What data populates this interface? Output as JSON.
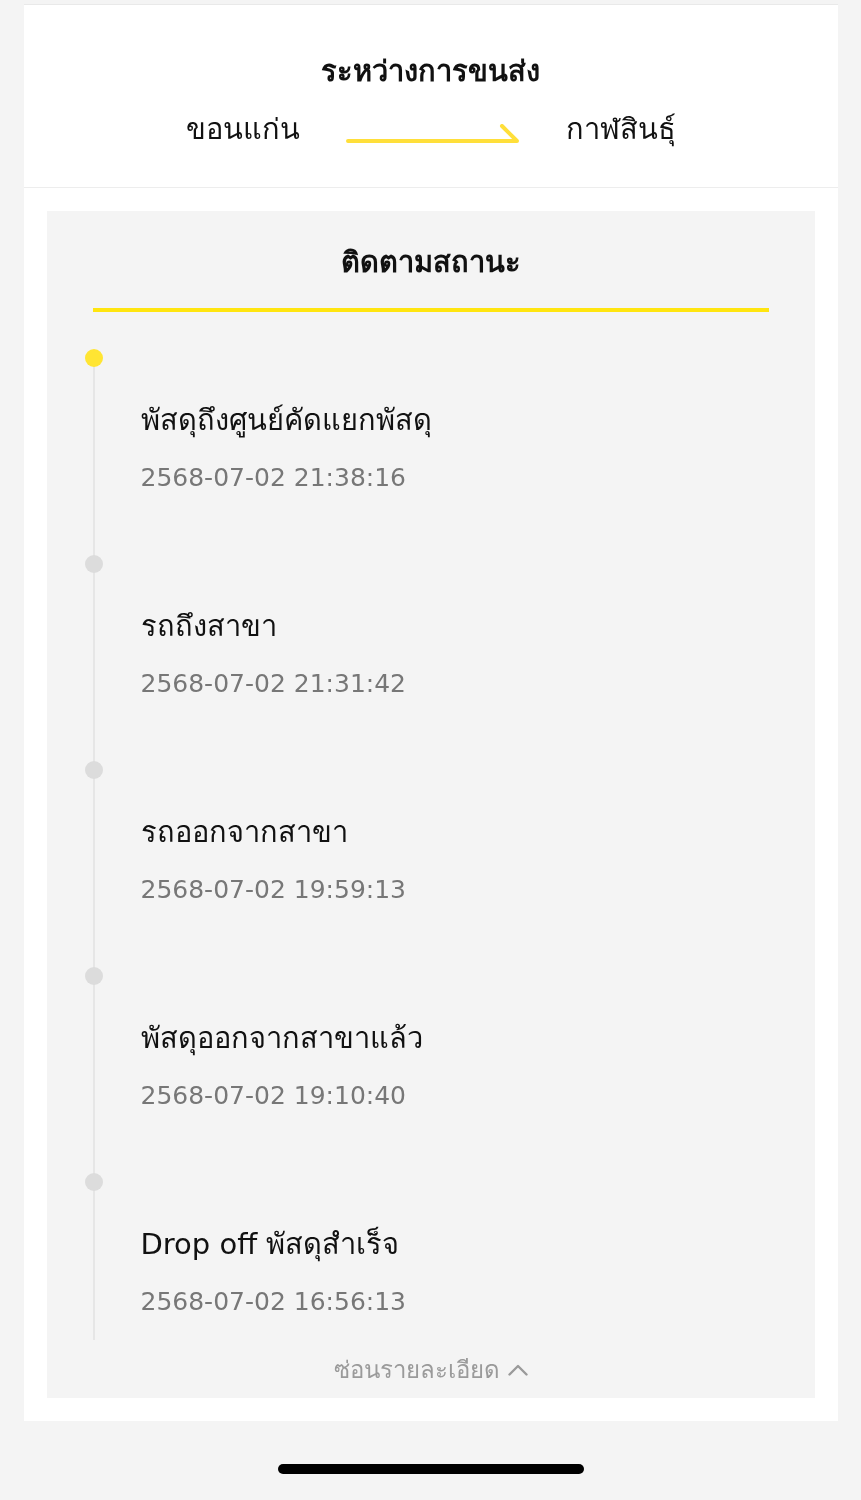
{
  "shipment": {
    "status": "ระหว่างการขนส่ง",
    "origin": "ขอนแก่น",
    "destination": "กาฬสินธุ์"
  },
  "tracking": {
    "title": "ติดตามสถานะ",
    "events": [
      {
        "status": "พัสดุถึงศูนย์คัดแยกพัสดุ",
        "time": "2568-07-02 21:38:16",
        "current": true
      },
      {
        "status": "รถถึงสาขา",
        "time": "2568-07-02 21:31:42",
        "current": false
      },
      {
        "status": "รถออกจากสาขา",
        "time": "2568-07-02 19:59:13",
        "current": false
      },
      {
        "status": "พัสดุออกจากสาขาแล้ว",
        "time": "2568-07-02 19:10:40",
        "current": false
      },
      {
        "status": "Drop off พัสดุสำเร็จ",
        "time": "2568-07-02 16:56:13",
        "current": false
      }
    ],
    "toggle": {
      "label": "ซ่อนรายละเอียด",
      "expanded": true
    }
  }
}
